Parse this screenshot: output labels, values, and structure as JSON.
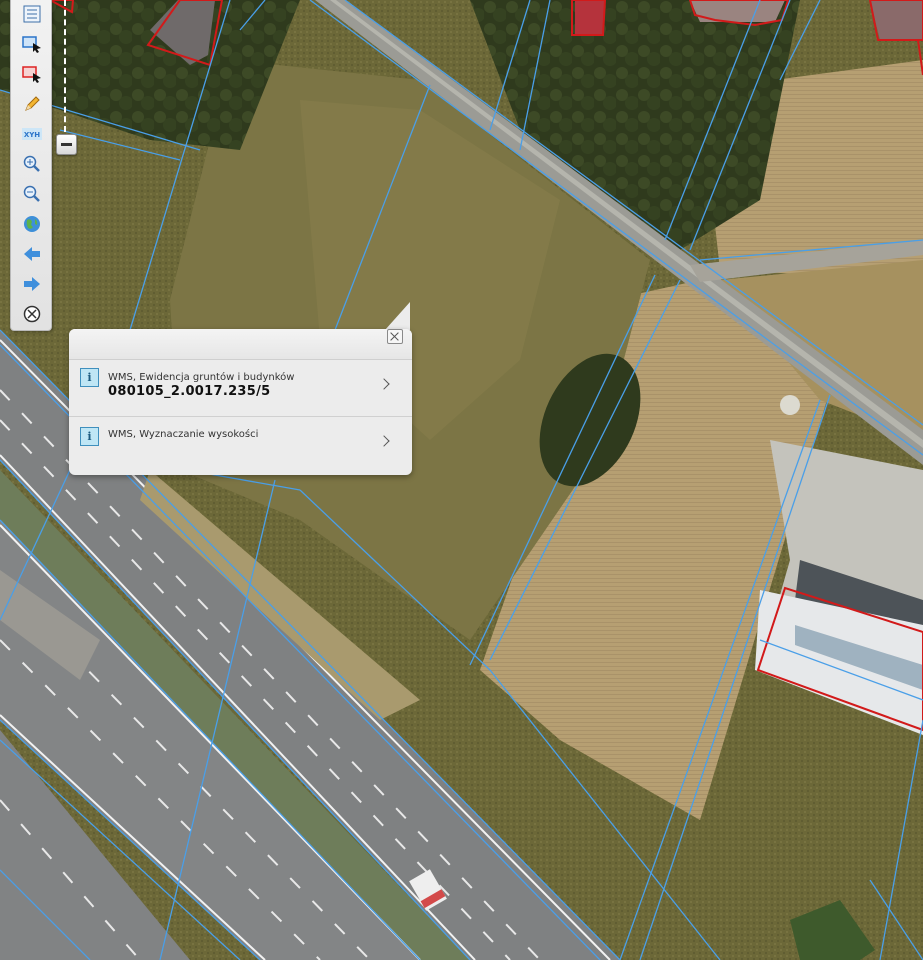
{
  "toolbar": {
    "tools": [
      {
        "name": "layers-list-icon"
      },
      {
        "name": "select-area-blue-icon"
      },
      {
        "name": "select-area-red-icon"
      },
      {
        "name": "edit-pencil-icon"
      },
      {
        "name": "xyh-coordinates-icon",
        "label": "XYH"
      },
      {
        "name": "zoom-in-icon"
      },
      {
        "name": "zoom-out-icon"
      },
      {
        "name": "globe-full-extent-icon"
      },
      {
        "name": "back-arrow-icon"
      },
      {
        "name": "forward-arrow-icon"
      },
      {
        "name": "clear-icon"
      }
    ]
  },
  "popup": {
    "results": [
      {
        "service": "WMS, Ewidencja gruntów i budynków",
        "value": "080105_2.0017.235/5"
      },
      {
        "service": "WMS, Wyznaczanie wysokości",
        "value": ""
      }
    ],
    "info_glyph": "i"
  },
  "colors": {
    "parcel_line": "#4a9fe8",
    "building_outline": "#d21a1a",
    "field_dry": "#b59e70",
    "meadow": "#6f6a3a",
    "road": "#8e9091"
  }
}
